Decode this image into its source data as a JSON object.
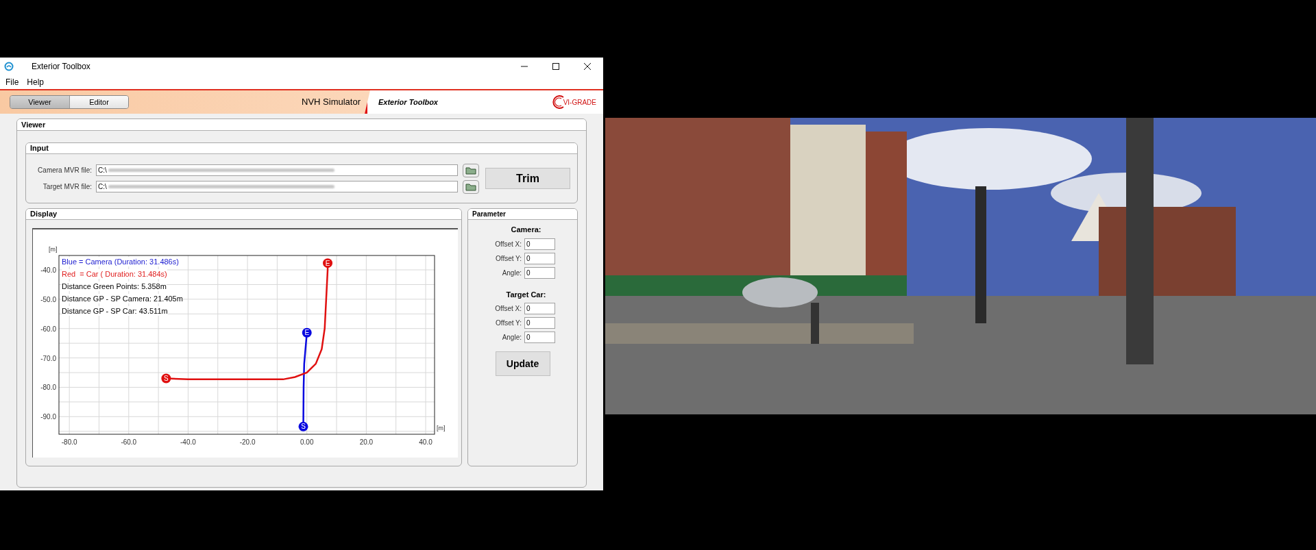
{
  "window": {
    "title": "Exterior Toolbox"
  },
  "menu": [
    "File",
    "Help"
  ],
  "mode_tabs": [
    {
      "label": "Viewer",
      "selected": true
    },
    {
      "label": "Editor",
      "selected": false
    }
  ],
  "banner": {
    "product": "NVH Simulator",
    "module": "Exterior Toolbox",
    "logo": "VI-GRADE"
  },
  "viewer": {
    "title": "Viewer",
    "input": {
      "title": "Input",
      "files": [
        {
          "label": "Camera MVR file:",
          "value": "C:\\"
        },
        {
          "label": "Target MVR file:",
          "value": "C:\\"
        }
      ],
      "trim_button": "Trim"
    },
    "display": {
      "title": "Display",
      "info_lines": [
        {
          "text": "Blue = Camera (Duration: 31.486s)",
          "color": "#1a1ad0"
        },
        {
          "text": "Red  = Car ( Duration: 31.484s)",
          "color": "#e02020"
        },
        {
          "text": "Distance Green Points: 5.358m",
          "color": "#000000"
        },
        {
          "text": "Distance GP - SP Camera: 21.405m",
          "color": "#000000"
        },
        {
          "text": "Distance GP - SP Car: 43.511m",
          "color": "#000000"
        }
      ],
      "chart_data": {
        "type": "line",
        "grid": true,
        "xlabel": "[m]",
        "ylabel": "[m]",
        "xlim": [
          -83.5,
          43
        ],
        "ylim": [
          -96,
          -35.1
        ],
        "xticks": [
          {
            "value": -80,
            "label": "-80.0"
          },
          {
            "value": -60,
            "label": "-60.0"
          },
          {
            "value": -40,
            "label": "-40.0"
          },
          {
            "value": -20,
            "label": "-20.0"
          },
          {
            "value": 0,
            "label": "0.00"
          },
          {
            "value": 20,
            "label": "20.0"
          },
          {
            "value": 40,
            "label": "40.0"
          }
        ],
        "yticks": [
          {
            "value": -40,
            "label": "-40.0"
          },
          {
            "value": -50,
            "label": "-50.0"
          },
          {
            "value": -60,
            "label": "-60.0"
          },
          {
            "value": -70,
            "label": "-70.0"
          },
          {
            "value": -80,
            "label": "-80.0"
          },
          {
            "value": -90,
            "label": "-90.0"
          }
        ],
        "series": [
          {
            "color": "#0a0ae0",
            "x": [
              -1.2,
              -1.1,
              -0.9,
              0
            ],
            "values": [
              -93.4,
              -80,
              -72,
              -61.4
            ]
          },
          {
            "color": "#e01010",
            "x": [
              -47.4,
              -40,
              -8,
              -4,
              0,
              3,
              5,
              6,
              6.5,
              7,
              7
            ],
            "values": [
              -77,
              -77.3,
              -77.3,
              -76.5,
              -75,
              -72,
              -67,
              -60,
              -50,
              -40,
              -37.7
            ]
          }
        ],
        "annotations": [
          {
            "text": "S",
            "x": -1.2,
            "y": -93.4
          },
          {
            "text": "E",
            "x": 0,
            "y": -61.4
          },
          {
            "text": "S",
            "x": -47.4,
            "y": -77
          },
          {
            "text": "E",
            "x": 7,
            "y": -37.7
          }
        ]
      }
    },
    "parameter": {
      "title": "Parameter",
      "groups": [
        {
          "title": "Camera:",
          "fields": [
            {
              "label": "Offset X:",
              "value": "0"
            },
            {
              "label": "Offset Y:",
              "value": "0"
            },
            {
              "label": "Angle:",
              "value": "0"
            }
          ]
        },
        {
          "title": "Target Car:",
          "fields": [
            {
              "label": "Offset X:",
              "value": "0"
            },
            {
              "label": "Offset Y:",
              "value": "0"
            },
            {
              "label": "Angle:",
              "value": "0"
            }
          ]
        }
      ],
      "update_button": "Update"
    }
  },
  "scene": {
    "kind": "picture"
  }
}
